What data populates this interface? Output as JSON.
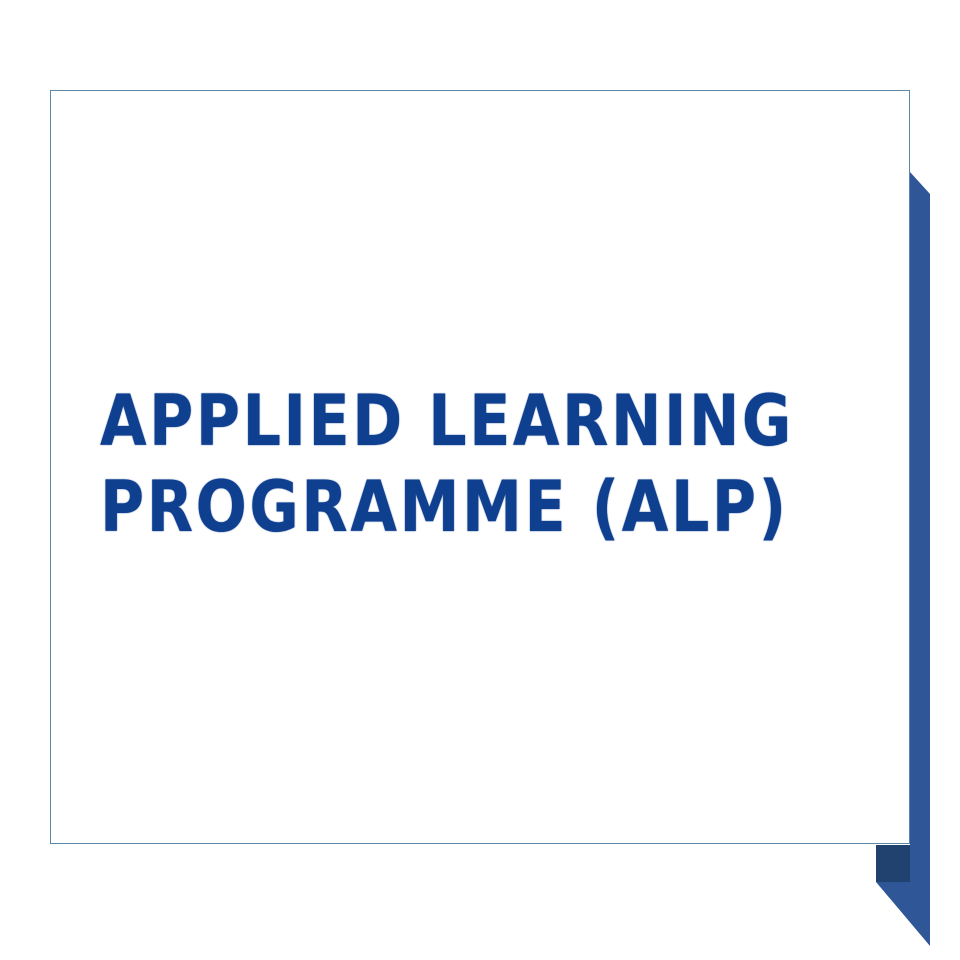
{
  "slide": {
    "title_lines": [
      "APPLIED LEARNING",
      "PROGRAMME (ALP)"
    ],
    "colors": {
      "title": "#0f3f8f",
      "accent_ribbon": "#2f5697",
      "accent_ribbon_dark": "#21416f",
      "card_border": "#5b86a8",
      "background": "#ffffff"
    }
  }
}
